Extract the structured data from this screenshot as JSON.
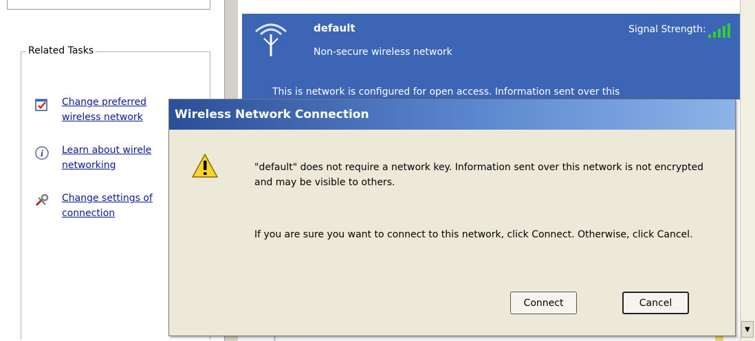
{
  "related_tasks": {
    "title": "Related Tasks",
    "items": [
      {
        "label_line1": "Change preferred",
        "label_line2": "wireless network",
        "icon": "preferred-network-icon"
      },
      {
        "label_line1": "Learn about wirele",
        "label_line2": "networking",
        "icon": "info-icon"
      },
      {
        "label_line1": "Change settings of",
        "label_line2": "connection",
        "icon": "settings-icon"
      }
    ]
  },
  "network": {
    "name": "default",
    "security": "Non-secure wireless network",
    "description": "This is network is configured for open access. Information sent over this",
    "signal_label": "Signal Strength:",
    "signal_level": 1.0,
    "icon": "wireless-antenna-icon"
  },
  "dialog": {
    "title": "Wireless Network Connection",
    "icon": "warning-icon",
    "message1": "\"default\" does not require a network key. Information sent over this network is not encrypted and may be visible to others.",
    "message2": "If you are sure you want to connect to this network, click Connect. Otherwise, click Cancel.",
    "connect_label": "Connect",
    "cancel_label": "Cancel"
  },
  "colors": {
    "card_blue": "#3c65b6",
    "title_gradient_start": "#2b4f99",
    "title_gradient_end": "#8cb4e8",
    "link": "#0a1a9a",
    "signal_green": "#2fd02f"
  }
}
